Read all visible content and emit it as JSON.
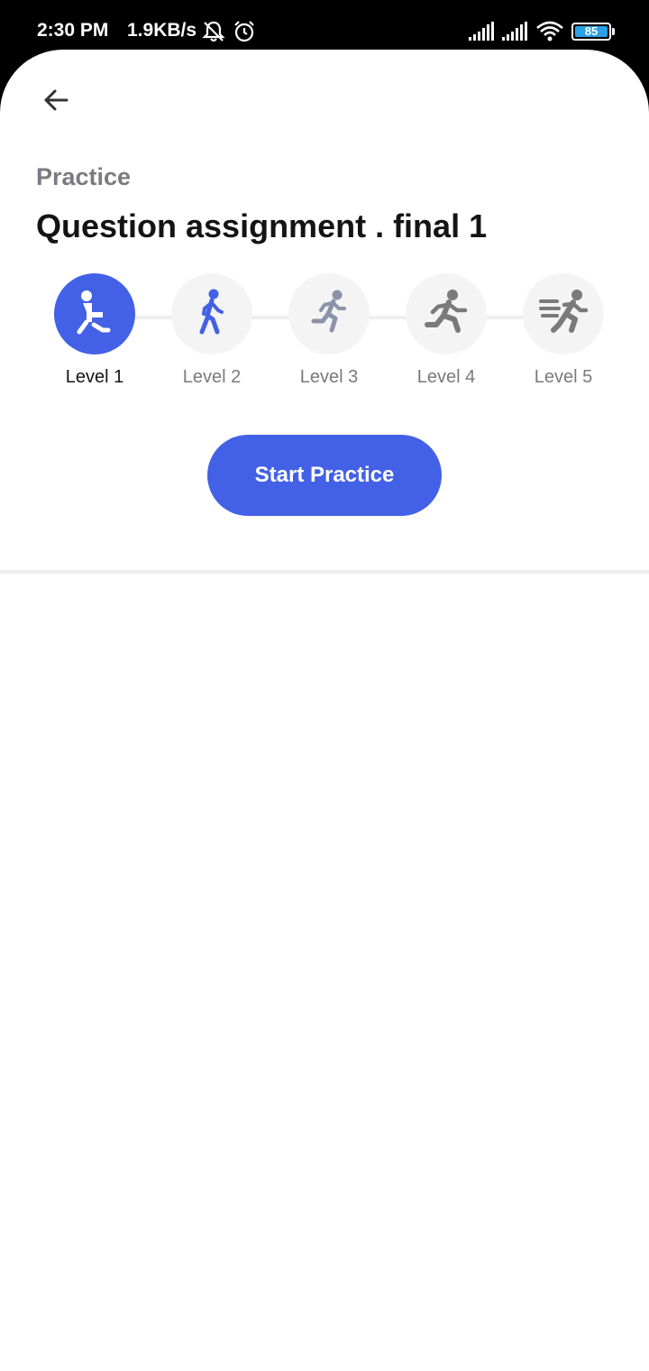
{
  "status_bar": {
    "time": "2:30 PM",
    "speed": "1.9KB/s",
    "battery": "85",
    "battery_color": "#2aa0e6"
  },
  "header": {
    "back_icon": "arrow-left-icon",
    "section": "Practice",
    "title": "Question assignment . final 1"
  },
  "levels": {
    "selected": "Level 1",
    "items": [
      {
        "label": "Level 1",
        "icon": "lunge-icon",
        "active": true
      },
      {
        "label": "Level 2",
        "icon": "walking-icon",
        "active": false
      },
      {
        "label": "Level 3",
        "icon": "jogging-icon",
        "active": false
      },
      {
        "label": "Level 4",
        "icon": "running-icon",
        "active": false
      },
      {
        "label": "Level 5",
        "icon": "sprinting-icon",
        "active": false
      }
    ]
  },
  "actions": {
    "start_label": "Start Practice"
  },
  "colors": {
    "accent": "#4361e6",
    "inactive_circle": "#f4f4f5",
    "muted_text": "#7a7a80"
  }
}
